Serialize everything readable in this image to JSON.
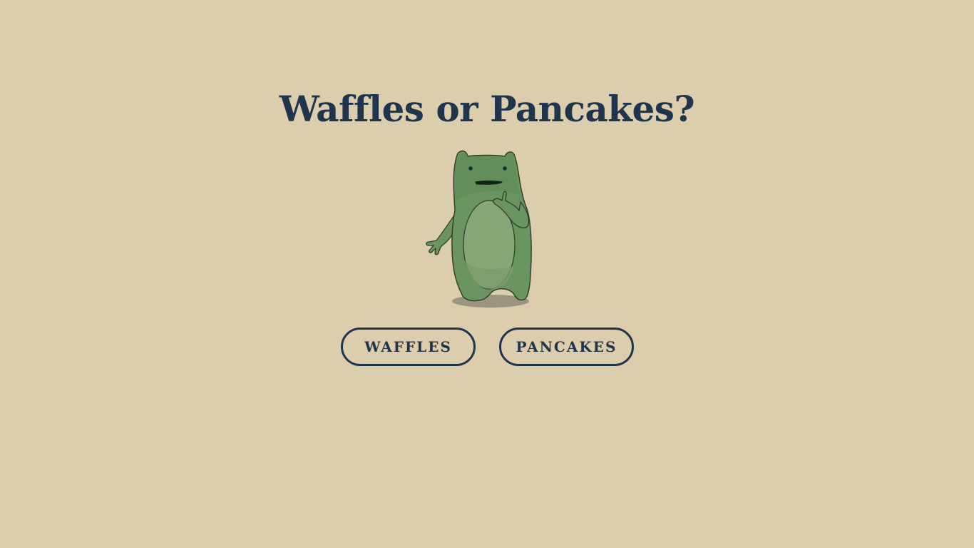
{
  "page": {
    "title": "Waffles or Pancakes?"
  },
  "mascot": {
    "icon": "green-frog-creature-illustration"
  },
  "choices": {
    "waffles_label": "WAFFLES",
    "pancakes_label": "PANCAKES"
  },
  "colors": {
    "background": "#dccdad",
    "text": "#1f344d",
    "creature_body": "#6a9560",
    "creature_belly": "#89a679",
    "shadow": "#9b9480"
  }
}
